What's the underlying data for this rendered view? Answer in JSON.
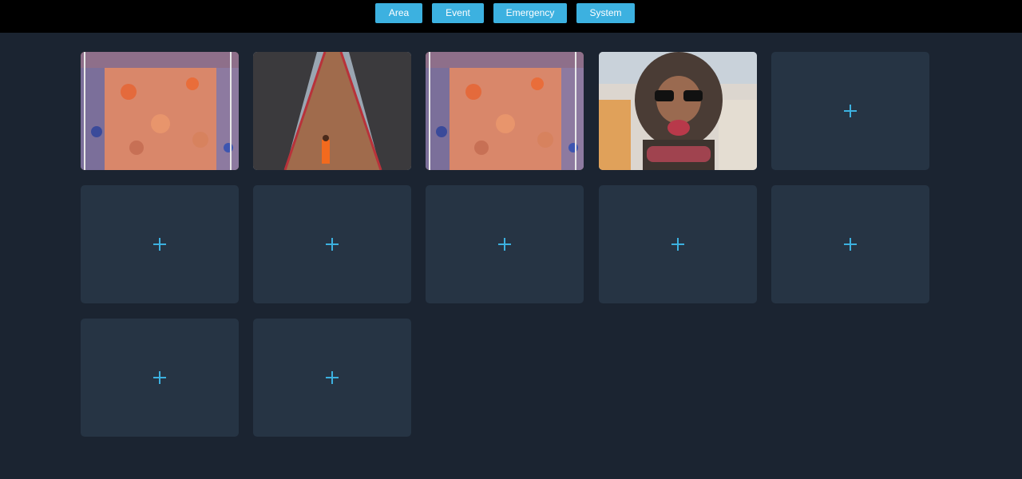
{
  "nav": {
    "area": "Area",
    "event": "Event",
    "emergency": "Emergency",
    "system": "System"
  },
  "grid": {
    "feeds": [
      {
        "type": "crowd"
      },
      {
        "type": "bridge"
      },
      {
        "type": "crowd"
      },
      {
        "type": "portrait"
      }
    ],
    "empty_slots": 8,
    "add_icon": "plus-icon"
  },
  "colors": {
    "accent": "#3cb1e0",
    "background": "#1b2431",
    "tile": "#263444",
    "topbar": "#000000"
  }
}
